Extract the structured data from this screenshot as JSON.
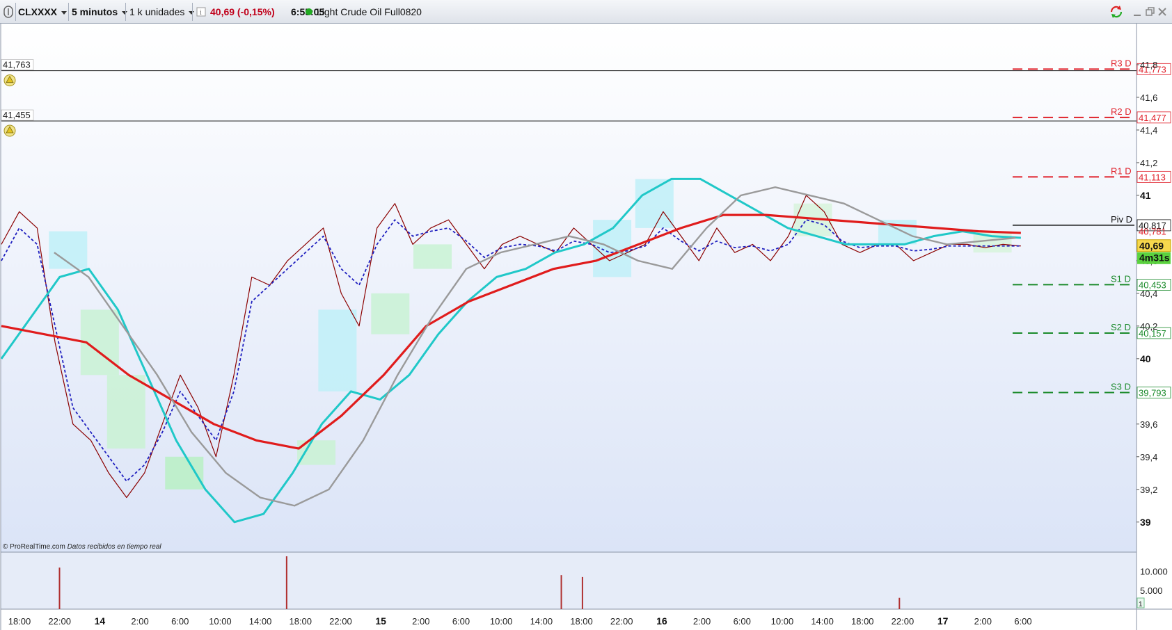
{
  "toolbar": {
    "symbol": "CLXXXX",
    "timeframe": "5 minutos",
    "units": "1 k unidades",
    "info_icon": "info-icon",
    "price_change": "40,69 (-0,15%)",
    "time": "6:55:05",
    "instrument": "Light Crude Oil Full0820",
    "colors": {
      "price_change": "#c0001a",
      "live_dot": "#22aa22"
    }
  },
  "window_controls": [
    "refresh-icon",
    "minimize-icon",
    "restore-icon",
    "close-icon"
  ],
  "alerts": [
    {
      "value": "41,763",
      "price": 41.763,
      "icon": "bell-icon"
    },
    {
      "value": "41,455",
      "price": 41.455,
      "icon": "bell-icon"
    }
  ],
  "pivots": [
    {
      "label": "R3 D",
      "value": "41,773",
      "price": 41.773,
      "color": "#e0202a"
    },
    {
      "label": "R2 D",
      "value": "41,477",
      "price": 41.477,
      "color": "#e0202a"
    },
    {
      "label": "R1 D",
      "value": "41,113",
      "price": 41.113,
      "color": "#e0202a"
    },
    {
      "label": "Piv D",
      "value": "40,817",
      "price": 40.817,
      "color": "#111111"
    },
    {
      "label": "S1 D",
      "value": "40,453",
      "price": 40.453,
      "color": "#1a8a2a"
    },
    {
      "label": "S2 D",
      "value": "40,157",
      "price": 40.157,
      "color": "#1a8a2a"
    },
    {
      "label": "S3 D",
      "value": "39,793",
      "price": 39.793,
      "color": "#1a8a2a"
    }
  ],
  "price_axis": {
    "ticks": [
      {
        "label": "41,8",
        "value": 41.8,
        "bold": false
      },
      {
        "label": "41,6",
        "value": 41.6,
        "bold": false
      },
      {
        "label": "41,4",
        "value": 41.4,
        "bold": false
      },
      {
        "label": "41,2",
        "value": 41.2,
        "bold": false
      },
      {
        "label": "41",
        "value": 41.0,
        "bold": true
      },
      {
        "label": "40,6",
        "value": 40.6,
        "bold": false
      },
      {
        "label": "40,4",
        "value": 40.4,
        "bold": false
      },
      {
        "label": "40,2",
        "value": 40.2,
        "bold": false
      },
      {
        "label": "40",
        "value": 40.0,
        "bold": true
      },
      {
        "label": "39,6",
        "value": 39.6,
        "bold": false
      },
      {
        "label": "39,4",
        "value": 39.4,
        "bold": false
      },
      {
        "label": "39,2",
        "value": 39.2,
        "bold": false
      },
      {
        "label": "39",
        "value": 39.0,
        "bold": true
      }
    ],
    "range": [
      38.85,
      42.0
    ],
    "hidden_marker": "40,781",
    "current_price": "40,69",
    "current_price_value": 40.69,
    "countdown": "4m31s"
  },
  "volume_axis": {
    "ticks": [
      {
        "label": "10.000",
        "value": 10000
      },
      {
        "label": "5.000",
        "value": 5000
      }
    ],
    "badge": "1"
  },
  "time_axis": {
    "labels": [
      {
        "label": "18:00",
        "bold": false
      },
      {
        "label": "22:00",
        "bold": false
      },
      {
        "label": "14",
        "bold": true
      },
      {
        "label": "2:00",
        "bold": false
      },
      {
        "label": "6:00",
        "bold": false
      },
      {
        "label": "10:00",
        "bold": false
      },
      {
        "label": "14:00",
        "bold": false
      },
      {
        "label": "18:00",
        "bold": false
      },
      {
        "label": "22:00",
        "bold": false
      },
      {
        "label": "15",
        "bold": true
      },
      {
        "label": "2:00",
        "bold": false
      },
      {
        "label": "6:00",
        "bold": false
      },
      {
        "label": "10:00",
        "bold": false
      },
      {
        "label": "14:00",
        "bold": false
      },
      {
        "label": "18:00",
        "bold": false
      },
      {
        "label": "22:00",
        "bold": false
      },
      {
        "label": "16",
        "bold": true
      },
      {
        "label": "2:00",
        "bold": false
      },
      {
        "label": "6:00",
        "bold": false
      },
      {
        "label": "10:00",
        "bold": false
      },
      {
        "label": "14:00",
        "bold": false
      },
      {
        "label": "18:00",
        "bold": false
      },
      {
        "label": "22:00",
        "bold": false
      },
      {
        "label": "17",
        "bold": true
      },
      {
        "label": "2:00",
        "bold": false
      },
      {
        "label": "6:00",
        "bold": false
      }
    ]
  },
  "footer": {
    "copyright": "© ProRealTime.com",
    "note": "Datos recibidos en tiempo real"
  },
  "chart_data": {
    "type": "line",
    "ylim": [
      38.85,
      42.0
    ],
    "series": [
      {
        "values": [
          40.7,
          40.9,
          40.8,
          40.1,
          39.6,
          39.5,
          39.3,
          39.15,
          39.3,
          39.6,
          39.9,
          39.7,
          39.4,
          39.9,
          40.5,
          40.45,
          40.6,
          40.7,
          40.8,
          40.4,
          40.2,
          40.8,
          40.95,
          40.7,
          40.8,
          40.85,
          40.7,
          40.55,
          40.7,
          40.75,
          40.7,
          40.65,
          40.8,
          40.7,
          40.6,
          40.65,
          40.7,
          40.9,
          40.75,
          40.6,
          40.8,
          40.65,
          40.7,
          40.6,
          40.75,
          41.0,
          40.9,
          40.7,
          40.65,
          40.7,
          40.7,
          40.6,
          40.65,
          40.7,
          40.7,
          40.68,
          40.7,
          40.69
        ],
        "color": "#8b0000"
      },
      {
        "values": [
          40.6,
          40.8,
          40.7,
          40.2,
          39.7,
          39.55,
          39.4,
          39.25,
          39.35,
          39.55,
          39.8,
          39.65,
          39.5,
          39.8,
          40.35,
          40.45,
          40.55,
          40.65,
          40.75,
          40.55,
          40.45,
          40.7,
          40.85,
          40.75,
          40.78,
          40.8,
          40.72,
          40.62,
          40.68,
          40.7,
          40.69,
          40.66,
          40.72,
          40.7,
          40.65,
          40.66,
          40.69,
          40.8,
          40.72,
          40.66,
          40.72,
          40.68,
          40.69,
          40.66,
          40.7,
          40.85,
          40.82,
          40.72,
          40.68,
          40.69,
          40.69,
          40.66,
          40.67,
          40.69,
          40.69,
          40.69,
          40.69,
          40.69
        ],
        "color": "#1f1fbf"
      },
      {
        "values": [
          40.0,
          40.25,
          40.5,
          40.55,
          40.3,
          39.9,
          39.5,
          39.2,
          39.0,
          39.05,
          39.3,
          39.6,
          39.8,
          39.75,
          39.9,
          40.15,
          40.35,
          40.5,
          40.55,
          40.65,
          40.7,
          40.8,
          41.0,
          41.1,
          41.1,
          41.0,
          40.9,
          40.8,
          40.75,
          40.7,
          40.7,
          40.7,
          40.75,
          40.78,
          40.75,
          40.74
        ],
        "color": "#20c8c8"
      },
      {
        "values": [
          40.2,
          40.15,
          40.1,
          39.9,
          39.75,
          39.6,
          39.5,
          39.45,
          39.65,
          39.9,
          40.2,
          40.35,
          40.45,
          40.55,
          40.6,
          40.7,
          40.8,
          40.88,
          40.88,
          40.86,
          40.84,
          40.82,
          40.8,
          40.78,
          40.77
        ],
        "color": "#e01c1c"
      }
    ],
    "volume": {
      "range": [
        0,
        14000
      ],
      "peaks": [
        [
          0.055,
          11000
        ],
        [
          0.27,
          14000
        ],
        [
          0.53,
          9000
        ],
        [
          0.55,
          8500
        ],
        [
          0.85,
          3000
        ]
      ]
    }
  }
}
